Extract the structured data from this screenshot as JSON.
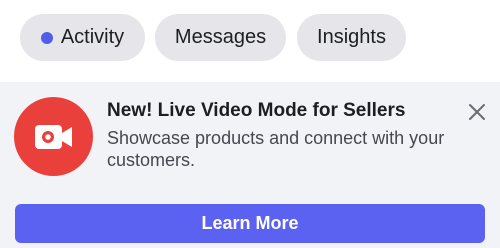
{
  "tabs": [
    {
      "label": "Activity",
      "has_dot": true
    },
    {
      "label": "Messages"
    },
    {
      "label": "Insights"
    }
  ],
  "banner": {
    "icon": "live-video-icon",
    "title": "New! Live Video Mode for Sellers",
    "description": "Showcase products and connect with your customers.",
    "close_icon": "close-icon",
    "button_label": "Learn More"
  },
  "colors": {
    "accent": "#5b61f0",
    "dot": "#4f5fe8",
    "icon_bg": "#e9403c",
    "chip_bg": "#e6e6ea",
    "banner_bg": "#f2f3f6"
  }
}
